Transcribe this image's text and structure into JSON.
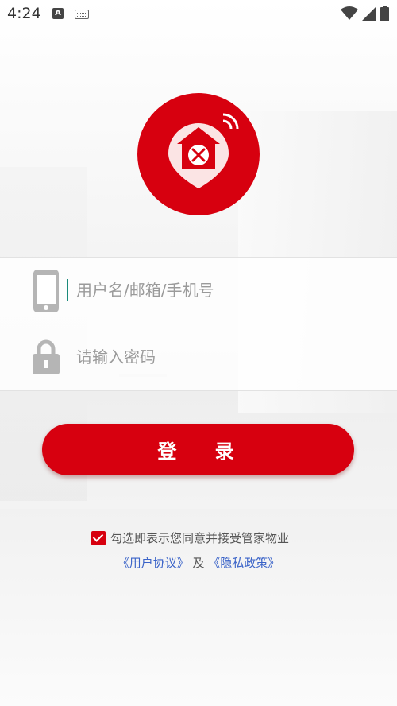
{
  "status_bar": {
    "time": "4:24",
    "a_icon": "A"
  },
  "login_form": {
    "username_placeholder": "用户名/邮箱/手机号",
    "password_placeholder": "请输入密码",
    "login_label": "登 录"
  },
  "agreement": {
    "checked": true,
    "text": "勾选即表示您同意并接受管家物业",
    "user_agreement": "《用户协议》",
    "and": " 及 ",
    "privacy_policy": "《隐私政策》"
  },
  "colors": {
    "brand": "#d7000f",
    "link": "#3a63c8"
  }
}
